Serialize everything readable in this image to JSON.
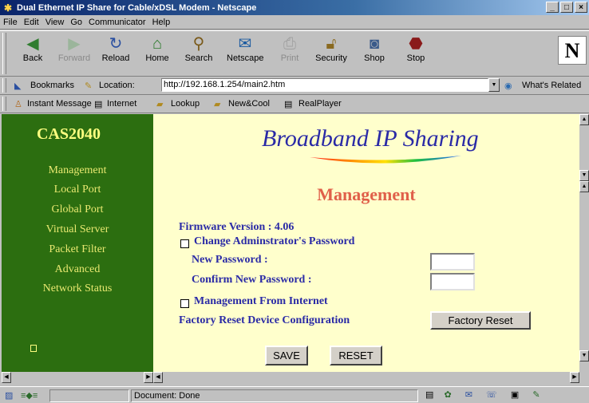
{
  "window": {
    "title": "Dual Ethernet IP Share for Cable/xDSL Modem - Netscape",
    "controls": [
      "_",
      "□",
      "×"
    ]
  },
  "menu": [
    "File",
    "Edit",
    "View",
    "Go",
    "Communicator",
    "Help"
  ],
  "toolbar": {
    "buttons": [
      {
        "label": "Back",
        "icon": "back-arrow-icon"
      },
      {
        "label": "Forward",
        "icon": "forward-arrow-icon",
        "disabled": true
      },
      {
        "label": "Reload",
        "icon": "reload-icon"
      },
      {
        "label": "Home",
        "icon": "home-icon"
      },
      {
        "label": "Search",
        "icon": "search-icon"
      },
      {
        "label": "Netscape",
        "icon": "netscape-icon"
      },
      {
        "label": "Print",
        "icon": "print-icon",
        "disabled": true
      },
      {
        "label": "Security",
        "icon": "lock-icon"
      },
      {
        "label": "Shop",
        "icon": "shop-icon"
      },
      {
        "label": "Stop",
        "icon": "stop-icon"
      }
    ],
    "logo": "N"
  },
  "location_bar": {
    "bookmarks_label": "Bookmarks",
    "location_label": "Location:",
    "url": "http://192.168.1.254/main2.htm",
    "whats_related": "What's Related"
  },
  "personal_toolbar": [
    "Instant Message",
    "Internet",
    "Lookup",
    "New&Cool",
    "RealPlayer"
  ],
  "sidebar": {
    "brand": "CAS2040",
    "nav": [
      "Management",
      "Local Port",
      "Global Port",
      "Virtual Server",
      "Packet Filter",
      "Advanced",
      "Network Status"
    ]
  },
  "main": {
    "logo_text": "Broadband IP Sharing",
    "heading": "Management",
    "firmware": "Firmware Version : 4.06",
    "change_password_label": "Change Adminstrator's Password",
    "new_password_label": "New Password :",
    "confirm_password_label": "Confirm New Password :",
    "mgmt_internet_label": "Management From Internet",
    "factory_reset_label": "Factory Reset Device Configuration",
    "factory_reset_button": "Factory Reset",
    "save_button": "SAVE",
    "reset_button": "RESET"
  },
  "status": {
    "text": "Document: Done"
  },
  "colors": {
    "sidebar_bg": "#2c6e10",
    "content_bg": "#ffffcc",
    "heading": "#e0604a",
    "label": "#2a2aa6"
  }
}
